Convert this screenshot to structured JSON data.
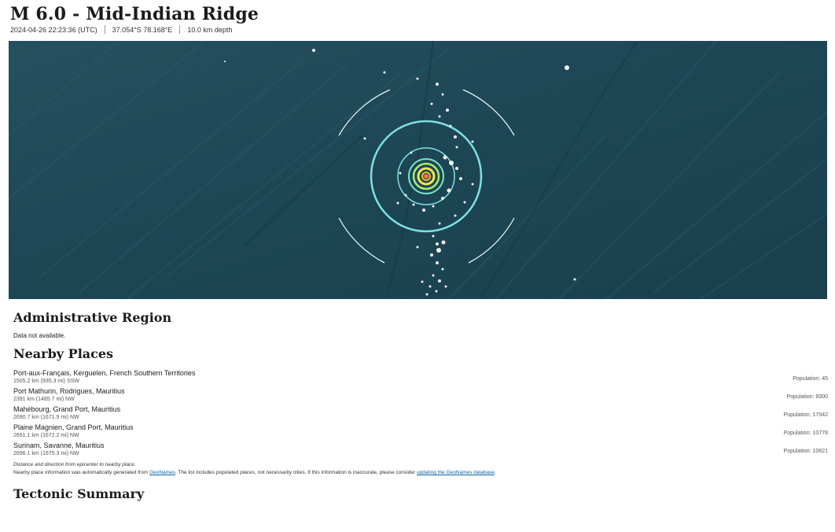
{
  "header": {
    "title": "M 6.0 - Mid-Indian Ridge",
    "datetime": "2024-04-26 22:23:36 (UTC)",
    "coords": "37.054°S 78.168°E",
    "depth": "10.0 km depth"
  },
  "map": {
    "ocean_color": "#1f4a5b",
    "ring_color": "#7fe0e0",
    "epicenter_color": "#f3e64a"
  },
  "admin_region": {
    "heading": "Administrative Region",
    "text": "Data not available."
  },
  "nearby": {
    "heading": "Nearby Places",
    "places": [
      {
        "name": "Port-aux-Français, Kerguelen, French Southern Territories",
        "dist": "1505.2 km (935.3 mi) SSW",
        "pop": "Population: 45"
      },
      {
        "name": "Port Mathurin, Rodrigues, Mauritius",
        "dist": "2391 km (1485.7 mi) NW",
        "pop": "Population: 6000"
      },
      {
        "name": "Mahébourg, Grand Port, Mauritius",
        "dist": "2690.7 km (1671.9 mi) NW",
        "pop": "Population: 17042"
      },
      {
        "name": "Plaine Magnien, Grand Port, Mauritius",
        "dist": "2691.1 km (1672.2 mi) NW",
        "pop": "Population: 10778"
      },
      {
        "name": "Surinam, Savanne, Mauritius",
        "dist": "2696.1 km (1675.3 mi) NW",
        "pop": "Population: 10621"
      }
    ],
    "note1": "Distance and direction from epicenter to nearby place.",
    "note2_pre": "Nearby place information was automatically generated from ",
    "note2_link1": "GeoNames",
    "note2_mid1": ". The list includes populated ",
    "note2_places": "places",
    "note2_mid2": ", not necessarily cities. If this information is inaccurate, please consider ",
    "note2_link2": "updating the GeoNames database",
    "note2_end": "."
  },
  "tectonic": {
    "heading": "Tectonic Summary"
  }
}
